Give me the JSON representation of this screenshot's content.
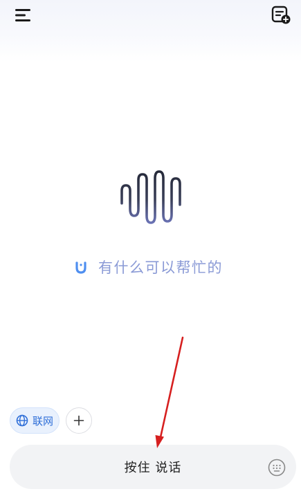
{
  "app": {
    "accent_color": "#2f6fd8",
    "prompt_color": "#8a9ad6"
  },
  "header": {
    "menu_icon": "hamburger-menu-icon",
    "new_chat_icon": "new-chat-icon"
  },
  "main": {
    "logo_icon": "sound-wave-logo-icon",
    "prompt_icon": "listening-mic-icon",
    "prompt_text": "有什么可以帮忙的"
  },
  "chips": {
    "web_label": "联网",
    "web_icon": "globe-icon",
    "plus_icon": "plus-icon"
  },
  "input": {
    "voice_label": "按住 说话",
    "keyboard_icon": "keyboard-icon"
  },
  "annotation": {
    "arrow_color": "#d61f1f"
  }
}
